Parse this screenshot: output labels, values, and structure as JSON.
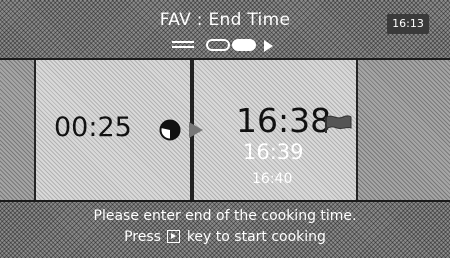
{
  "header": {
    "title": "FAV : End Time",
    "clock": "16:13"
  },
  "duration": {
    "value": "00:25",
    "icon": "half-circle-icon"
  },
  "end_time_options": {
    "selected": "16:38",
    "next": "16:39",
    "after": "16:40",
    "icon": "flag-icon"
  },
  "footer": {
    "line1": "Please enter end of the cooking time.",
    "line2_prefix": "Press",
    "line2_suffix": "key to start cooking",
    "key_icon": "start-key-icon"
  }
}
